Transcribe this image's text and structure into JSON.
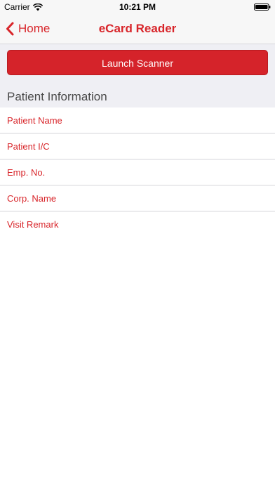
{
  "status_bar": {
    "carrier": "Carrier",
    "time": "10:21 PM"
  },
  "nav": {
    "back_label": "Home",
    "title": "eCard Reader"
  },
  "scanner": {
    "button_label": "Launch Scanner"
  },
  "section": {
    "title": "Patient Information"
  },
  "fields": [
    {
      "placeholder": "Patient Name",
      "value": ""
    },
    {
      "placeholder": "Patient I/C",
      "value": ""
    },
    {
      "placeholder": "Emp. No.",
      "value": ""
    },
    {
      "placeholder": "Corp. Name",
      "value": ""
    },
    {
      "placeholder": "Visit Remark",
      "value": ""
    }
  ],
  "colors": {
    "accent": "#d8252a",
    "button": "#d5232a",
    "background": "#efeff4"
  },
  "icons": {
    "wifi": "wifi-icon",
    "battery": "battery-icon",
    "back": "chevron-left-icon"
  }
}
